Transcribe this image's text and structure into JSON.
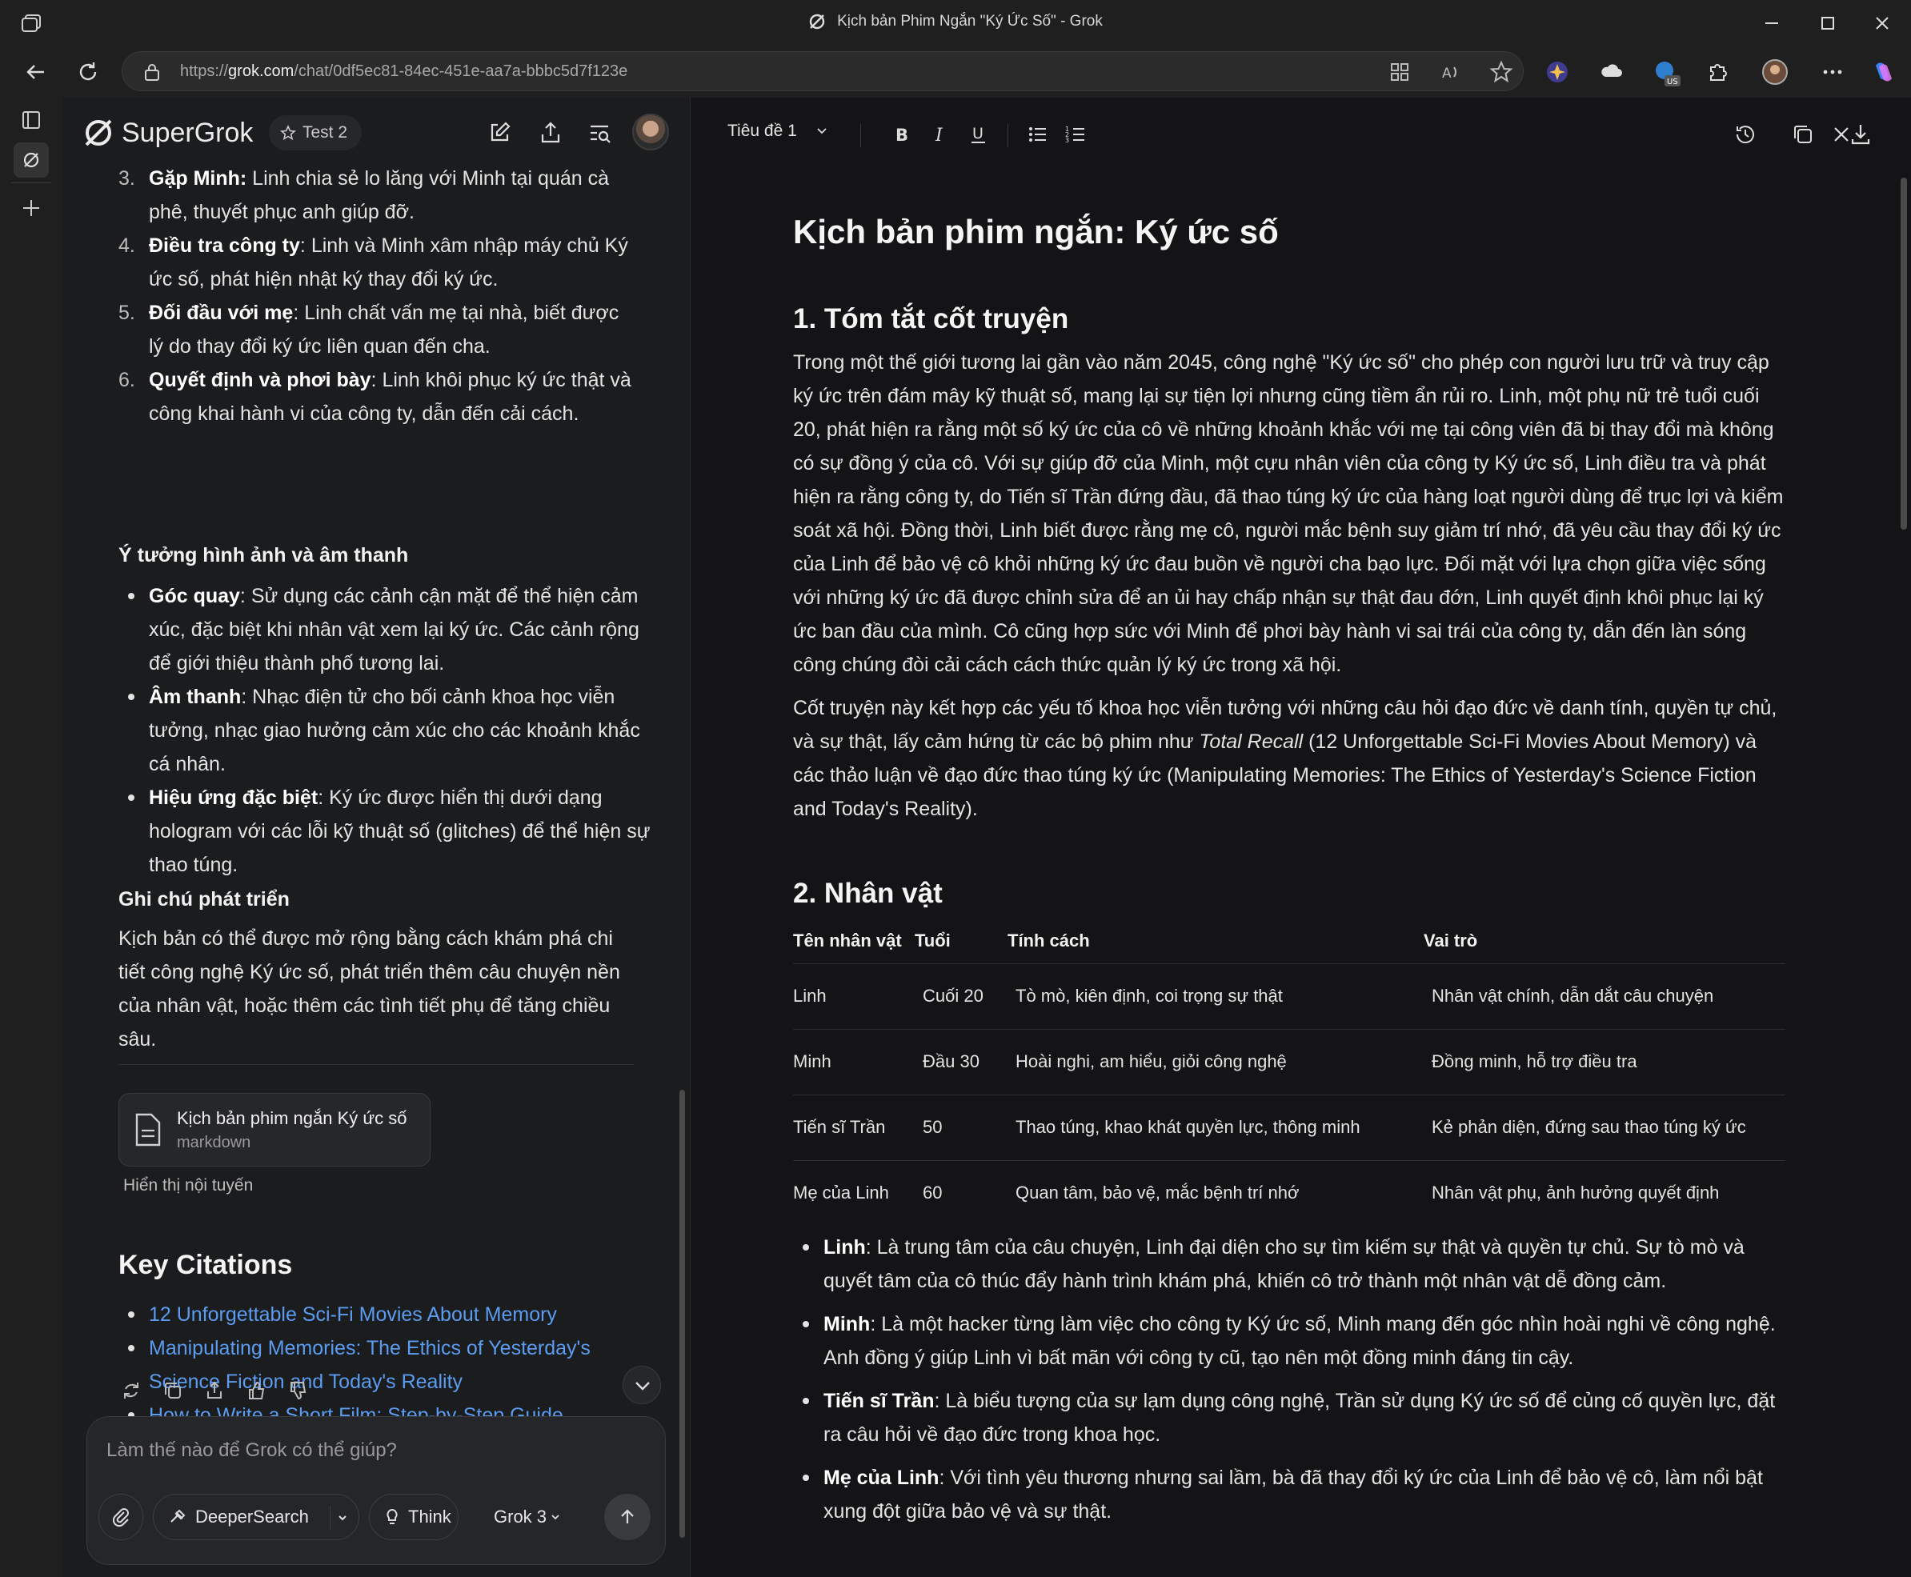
{
  "window": {
    "title": "Kịch bản Phim Ngắn \"Ký Ức Số\" - Grok"
  },
  "browser": {
    "url_prefix": "https://",
    "url_host": "grok.com",
    "url_path": "/chat/0df5ec81-84ec-451e-aa7a-bbbc5d7f123e"
  },
  "chat_header": {
    "brand": "SuperGrok",
    "project": "Test 2"
  },
  "chat": {
    "steps": [
      {
        "num": "3.",
        "title": "Gặp Minh:",
        "text": " Linh chia sẻ lo lắng với Minh tại quán cà phê, thuyết phục anh giúp đỡ."
      },
      {
        "num": "4.",
        "title": "Điều tra công ty",
        "text": ": Linh và Minh xâm nhập máy chủ Ký ức số, phát hiện nhật ký thay đổi ký ức."
      },
      {
        "num": "5.",
        "title": "Đối đầu với mẹ",
        "text": ": Linh chất vấn mẹ tại nhà, biết được lý do thay đổi ký ức liên quan đến cha."
      },
      {
        "num": "6.",
        "title": "Quyết định và phơi bày",
        "text": ": Linh khôi phục ký ức thật và công khai hành vi của công ty, dẫn đến cải cách."
      }
    ],
    "ideas_heading": "Ý tưởng hình ảnh và âm thanh",
    "ideas": [
      {
        "title": "Góc quay",
        "text": ": Sử dụng các cảnh cận mặt để thể hiện cảm xúc, đặc biệt khi nhân vật xem lại ký ức. Các cảnh rộng để giới thiệu thành phố tương lai."
      },
      {
        "title": "Âm thanh",
        "text": ": Nhạc điện tử cho bối cảnh khoa học viễn tưởng, nhạc giao hưởng cảm xúc cho các khoảnh khắc cá nhân."
      },
      {
        "title": "Hiệu ứng đặc biệt",
        "text": ": Ký ức được hiển thị dưới dạng hologram với các lỗi kỹ thuật số (glitches) để thể hiện sự thao túng."
      }
    ],
    "notes_heading": "Ghi chú phát triển",
    "notes_text": "Kịch bản có thể được mở rộng bằng cách khám phá chi tiết công nghệ Ký ức số, phát triển thêm câu chuyện nền của nhân vật, hoặc thêm các tình tiết phụ để tăng chiều sâu.",
    "doc_card": {
      "title": "Kịch bản phim ngắn Ký ức số",
      "type": "markdown"
    },
    "inline_link": "Hiển thị nội tuyến",
    "citations_heading": "Key Citations",
    "citations": [
      "12 Unforgettable Sci-Fi Movies About Memory",
      "Manipulating Memories: The Ethics of Yesterday's Science Fiction and Today's Reality",
      "How to Write a Short Film: Step-by-Step Guide"
    ]
  },
  "composer": {
    "placeholder": "Làm thế nào để Grok có thể giúp?",
    "deepersearch": "DeeperSearch",
    "think": "Think",
    "model": "Grok 3"
  },
  "doc_toolbar": {
    "style": "Tiêu đề 1"
  },
  "document": {
    "title": "Kịch bản phim ngắn: Ký ức số",
    "section1_heading": "1. Tóm tắt cốt truyện",
    "section1_p1": "Trong một thế giới tương lai gần vào năm 2045, công nghệ \"Ký ức số\" cho phép con người lưu trữ và truy cập ký ức trên đám mây kỹ thuật số, mang lại sự tiện lợi nhưng cũng tiềm ẩn rủi ro. Linh, một phụ nữ trẻ tuổi cuối 20, phát hiện ra rằng một số ký ức của cô về những khoảnh khắc với mẹ tại công viên đã bị thay đổi mà không có sự đồng ý của cô. Với sự giúp đỡ của Minh, một cựu nhân viên của công ty Ký ức số, Linh điều tra và phát hiện ra rằng công ty, do Tiến sĩ Trần đứng đầu, đã thao túng ký ức của hàng loạt người dùng để trục lợi và kiểm soát xã hội. Đồng thời, Linh biết được rằng mẹ cô, người mắc bệnh suy giảm trí nhớ, đã yêu cầu thay đổi ký ức của Linh để bảo vệ cô khỏi những ký ức đau buồn về người cha bạo lực. Đối mặt với lựa chọn giữa việc sống với những ký ức đã được chỉnh sửa để an ủi hay chấp nhận sự thật đau đớn, Linh quyết định khôi phục lại ký ức ban đầu của mình. Cô cũng hợp sức với Minh để phơi bày hành vi sai trái của công ty, dẫn đến làn sóng công chúng đòi cải cách cách thức quản lý ký ức trong xã hội.",
    "section1_p2_a": "Cốt truyện này kết hợp các yếu tố khoa học viễn tưởng với những câu hỏi đạo đức về danh tính, quyền tự chủ, và sự thật, lấy cảm hứng từ các bộ phim như ",
    "section1_p2_italic": "Total Recall",
    "section1_p2_b": " (12 Unforgettable Sci-Fi Movies About Memory) và các thảo luận về đạo đức thao túng ký ức (Manipulating Memories: The Ethics of Yesterday's Science Fiction and Today's Reality).",
    "section2_heading": "2. Nhân vật",
    "table_headers": {
      "name": "Tên nhân vật",
      "age": "Tuổi",
      "trait": "Tính cách",
      "role": "Vai trò"
    },
    "characters": [
      {
        "name": "Linh",
        "age": "Cuối 20",
        "trait": "Tò mò, kiên định, coi trọng sự thật",
        "role": "Nhân vật chính, dẫn dắt câu chuyện"
      },
      {
        "name": "Minh",
        "age": "Đầu 30",
        "trait": "Hoài nghi, am hiểu, giỏi công nghệ",
        "role": "Đồng minh, hỗ trợ điều tra"
      },
      {
        "name": "Tiến sĩ Trần",
        "age": "50",
        "trait": "Thao túng, khao khát quyền lực, thông minh",
        "role": "Kẻ phản diện, đứng sau thao túng ký ức"
      },
      {
        "name": "Mẹ của Linh",
        "age": "60",
        "trait": "Quan tâm, bảo vệ, mắc bệnh trí nhớ",
        "role": "Nhân vật phụ, ảnh hưởng quyết định"
      }
    ],
    "bullets": [
      {
        "title": "Linh",
        "text": ": Là trung tâm của câu chuyện, Linh đại diện cho sự tìm kiếm sự thật và quyền tự chủ. Sự tò mò và quyết tâm của cô thúc đẩy hành trình khám phá, khiến cô trở thành một nhân vật dễ đồng cảm."
      },
      {
        "title": "Minh",
        "text": ": Là một hacker từng làm việc cho công ty Ký ức số, Minh mang đến góc nhìn hoài nghi về công nghệ. Anh đồng ý giúp Linh vì bất mãn với công ty cũ, tạo nên một đồng minh đáng tin cậy."
      },
      {
        "title": "Tiến sĩ Trần",
        "text": ": Là biểu tượng của sự lạm dụng công nghệ, Trần sử dụng Ký ức số để củng cố quyền lực, đặt ra câu hỏi về đạo đức trong khoa học."
      },
      {
        "title": "Mẹ của Linh",
        "text": ": Với tình yêu thương nhưng sai lầm, bà đã thay đổi ký ức của Linh để bảo vệ cô, làm nổi bật xung đột giữa bảo vệ và sự thật."
      }
    ]
  },
  "colors": {
    "link": "#5b9cf0",
    "panel": "#141416",
    "chat_bg": "#1b1c1e"
  }
}
